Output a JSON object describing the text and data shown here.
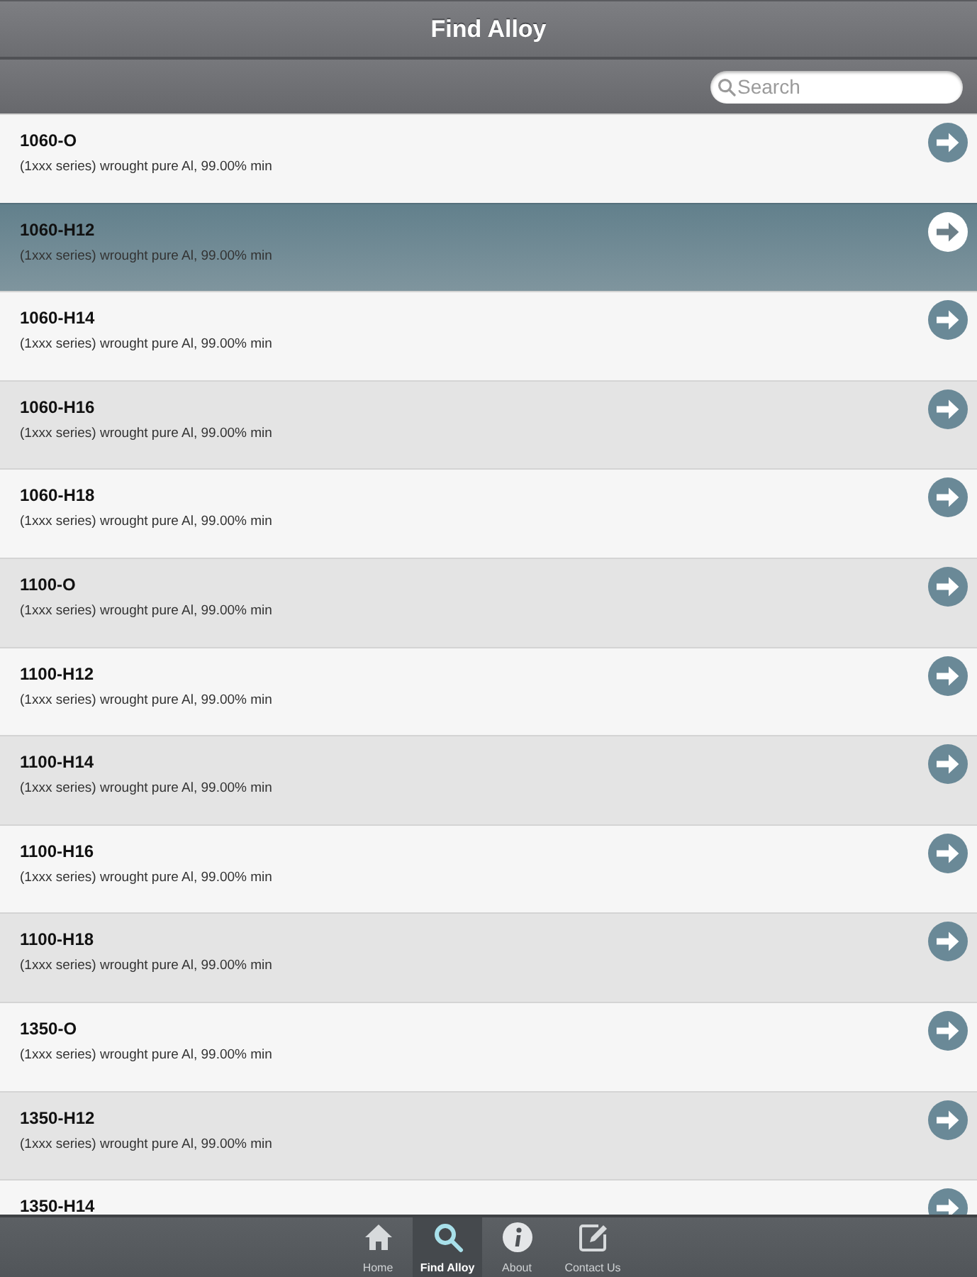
{
  "header": {
    "title": "Find Alloy"
  },
  "search": {
    "placeholder": "Search"
  },
  "alloys": [
    {
      "name": "1060-O",
      "description": "(1xxx series) wrought pure Al, 99.00% min",
      "selected": false
    },
    {
      "name": "1060-H12",
      "description": "(1xxx series) wrought pure Al, 99.00% min",
      "selected": true
    },
    {
      "name": "1060-H14",
      "description": "(1xxx series) wrought pure Al, 99.00% min",
      "selected": false
    },
    {
      "name": "1060-H16",
      "description": "(1xxx series) wrought pure Al, 99.00% min",
      "selected": false
    },
    {
      "name": "1060-H18",
      "description": "(1xxx series) wrought pure Al, 99.00% min",
      "selected": false
    },
    {
      "name": "1100-O",
      "description": "(1xxx series) wrought pure Al, 99.00% min",
      "selected": false
    },
    {
      "name": "1100-H12",
      "description": "(1xxx series) wrought pure Al, 99.00% min",
      "selected": false
    },
    {
      "name": "1100-H14",
      "description": "(1xxx series) wrought pure Al, 99.00% min",
      "selected": false
    },
    {
      "name": "1100-H16",
      "description": "(1xxx series) wrought pure Al, 99.00% min",
      "selected": false
    },
    {
      "name": "1100-H18",
      "description": "(1xxx series) wrought pure Al, 99.00% min",
      "selected": false
    },
    {
      "name": "1350-O",
      "description": "(1xxx series) wrought pure Al, 99.00% min",
      "selected": false
    },
    {
      "name": "1350-H12",
      "description": "(1xxx series) wrought pure Al, 99.00% min",
      "selected": false
    },
    {
      "name": "1350-H14",
      "selected": false
    }
  ],
  "tab_bar": {
    "tabs": [
      {
        "label": "Home",
        "kind": "home",
        "selected": false
      },
      {
        "label": "Find Alloy",
        "kind": "search",
        "selected": true
      },
      {
        "label": "About",
        "kind": "info",
        "selected": false
      },
      {
        "label": "Contact Us",
        "kind": "compose",
        "selected": false
      }
    ]
  }
}
